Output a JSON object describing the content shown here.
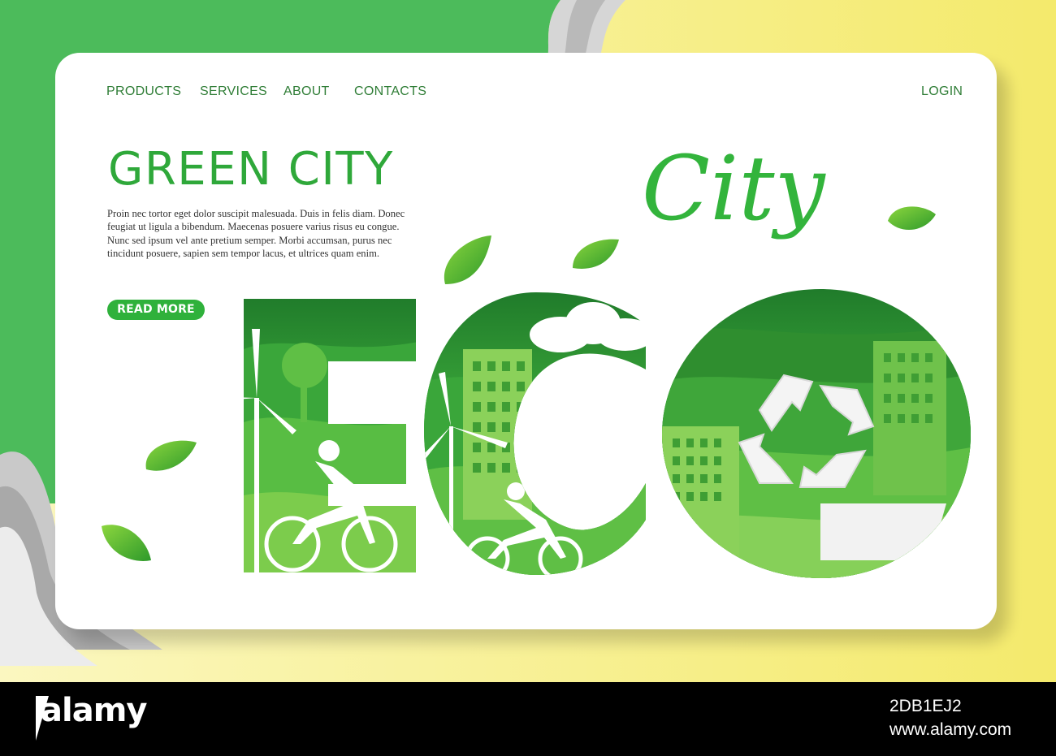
{
  "nav": {
    "items": [
      "PRODUCTS",
      "SERVICES",
      "ABOUT",
      "CONTACTS"
    ],
    "login_label": "LOGIN"
  },
  "hero": {
    "title": "GREEN CITY",
    "body": "Proin nec tortor eget dolor suscipit malesuada. Duis in felis diam. Donec feugiat ut ligula a bibendum. Maecenas posuere varius risus eu congue. Nunc sed ipsum vel ante pretium semper. Morbi accumsan, purus nec tincidunt posuere, sapien sem tempor lacus, et ultrices quam enim.",
    "cta_label": "READ MORE"
  },
  "illustration": {
    "script_word": "City",
    "icons": [
      "wind-turbine-icon",
      "cyclist-icon",
      "building-icon",
      "cloud-icon",
      "recycle-icon",
      "leaf-icon"
    ]
  },
  "watermark": {
    "brand": "alamy",
    "image_id": "2DB1EJ2",
    "site": "www.alamy.com"
  },
  "colors": {
    "accent": "#2fb13b",
    "nav_text": "#2f7d36",
    "left_background": "#4cbb5b",
    "right_background": "#f5ec78"
  }
}
